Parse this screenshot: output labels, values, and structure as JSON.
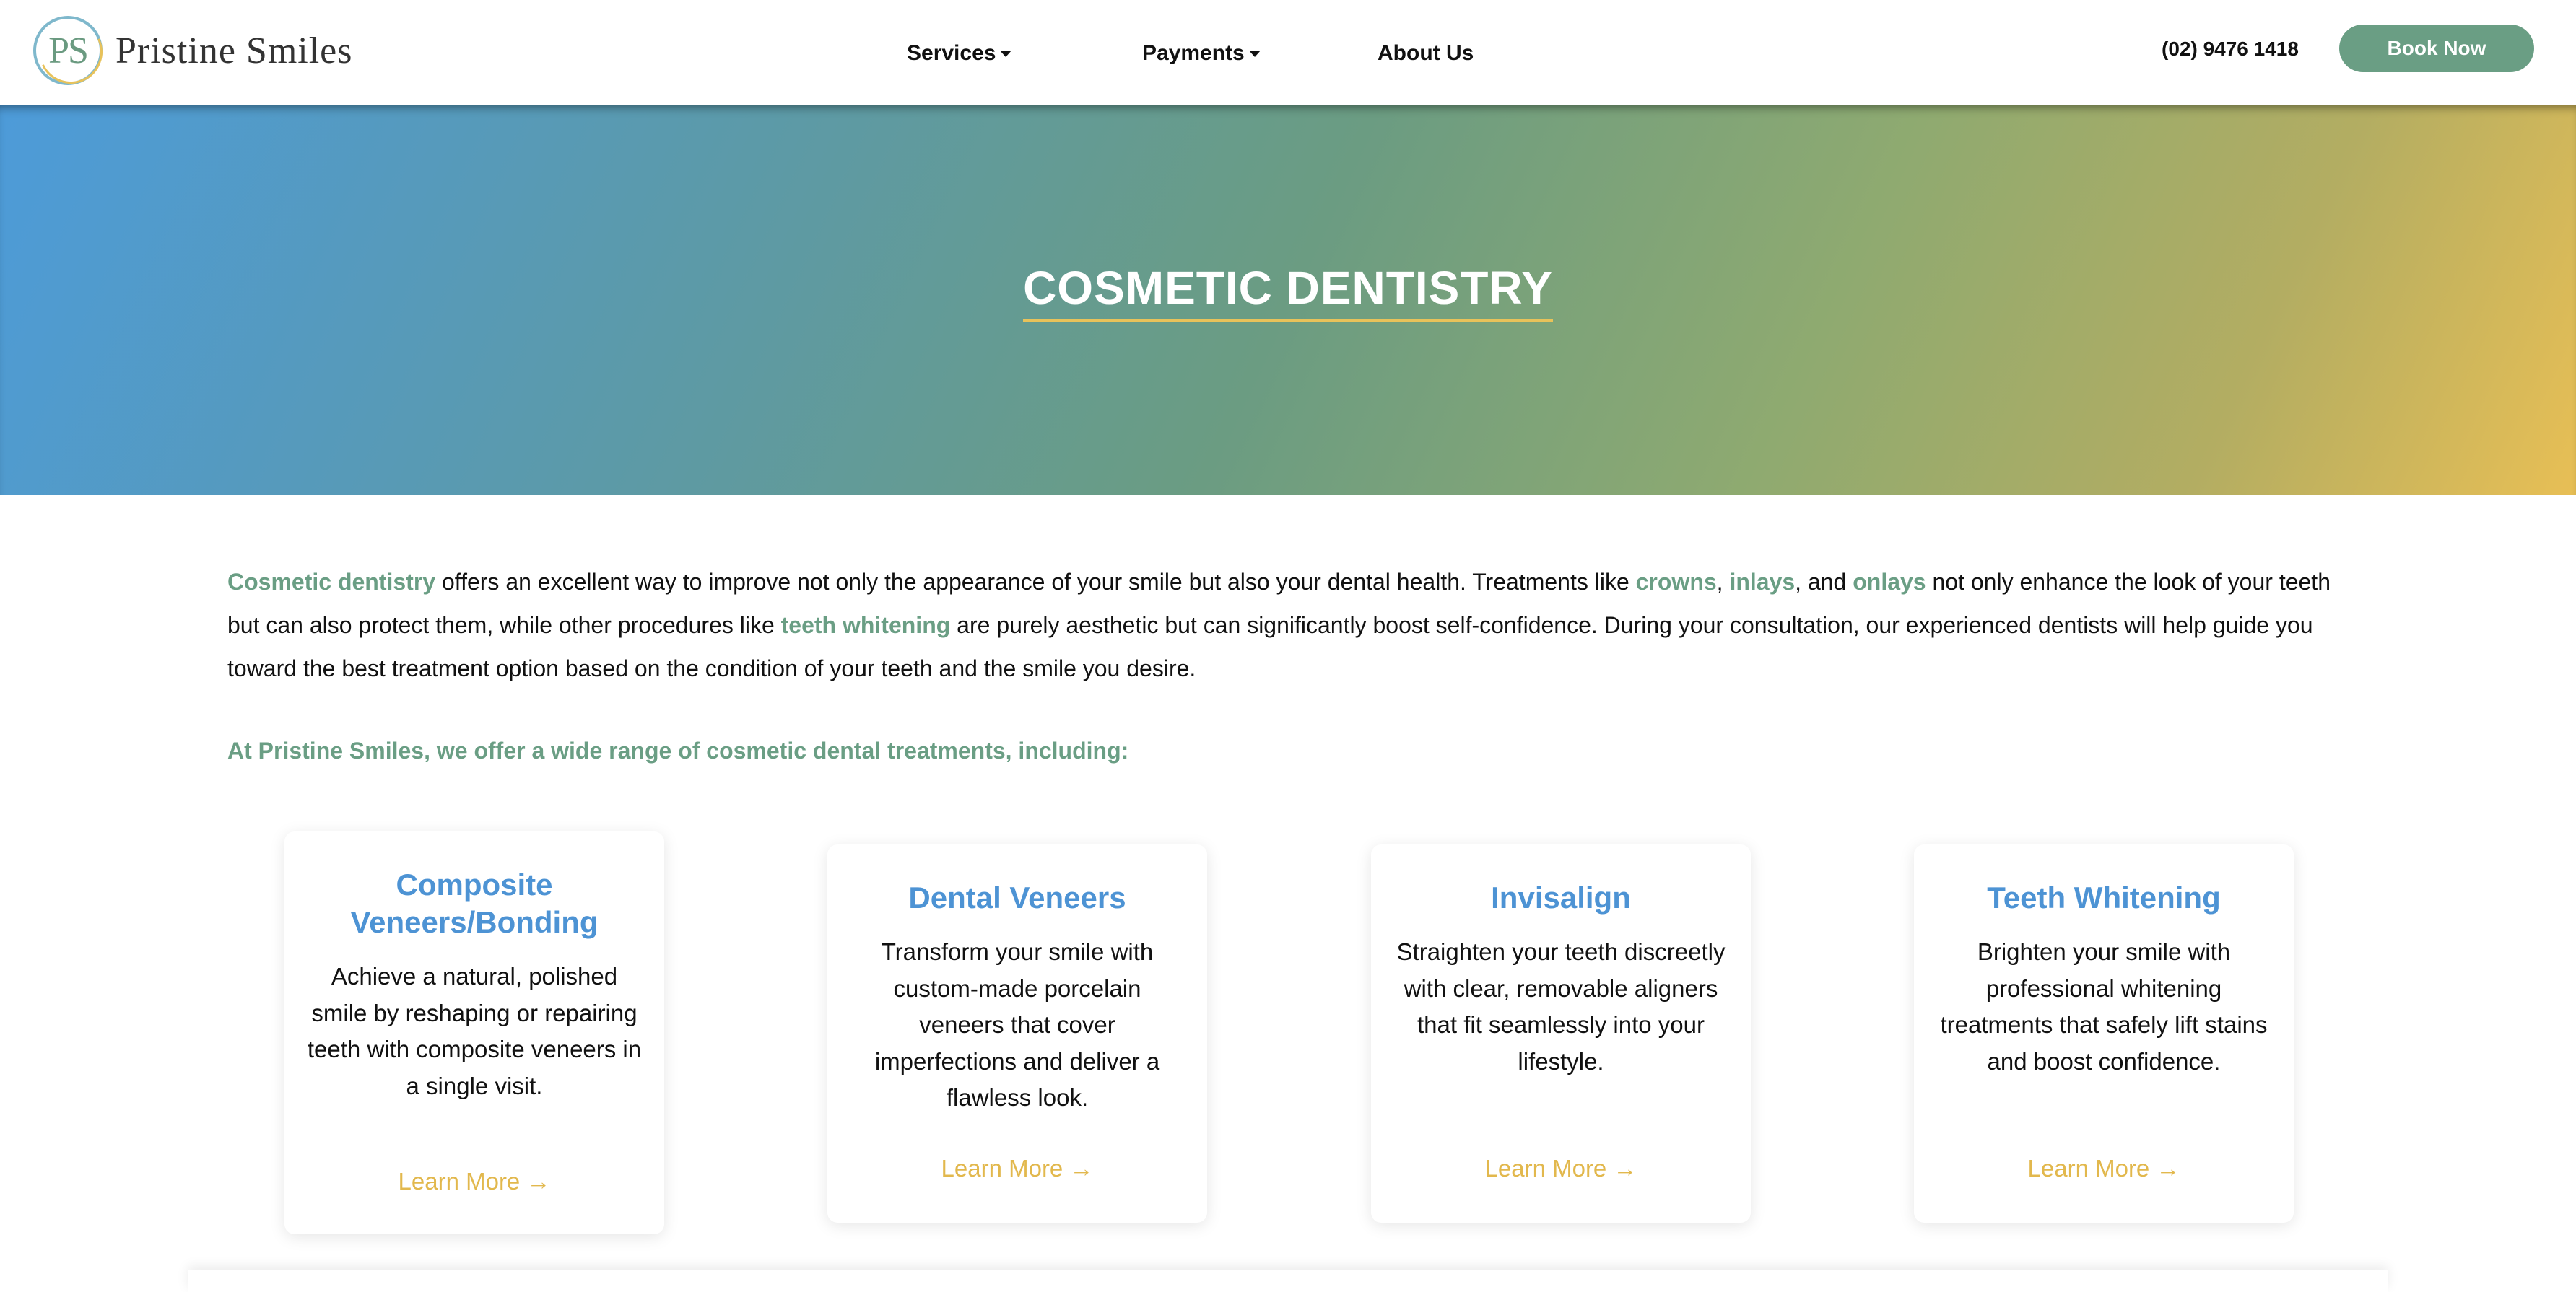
{
  "header": {
    "logo_initials": "PS",
    "logo_text": "Pristine Smiles",
    "nav": [
      {
        "label": "Services",
        "has_dropdown": true
      },
      {
        "label": "Payments",
        "has_dropdown": true
      },
      {
        "label": "About Us",
        "has_dropdown": false
      }
    ],
    "phone": "(02) 9476 1418",
    "book_label": "Book Now"
  },
  "hero": {
    "title": "COSMETIC DENTISTRY"
  },
  "intro": {
    "segments": [
      {
        "text": "Cosmetic dentistry",
        "highlight": true
      },
      {
        "text": " offers an excellent way to improve not only the appearance of your smile but also your dental health. Treatments like ",
        "highlight": false
      },
      {
        "text": "crowns",
        "highlight": true
      },
      {
        "text": ", ",
        "highlight": false
      },
      {
        "text": "inlays",
        "highlight": true
      },
      {
        "text": ", and ",
        "highlight": false
      },
      {
        "text": "onlays",
        "highlight": true
      },
      {
        "text": " not only enhance the look of your teeth but can also protect them, while other procedures like ",
        "highlight": false
      },
      {
        "text": "teeth whitening",
        "highlight": true
      },
      {
        "text": " are purely aesthetic but can significantly boost self-confidence. During your consultation, our experienced dentists will help guide you toward the best treatment option based on the condition of your teeth and the smile you desire.",
        "highlight": false
      }
    ],
    "subheading": "At Pristine Smiles, we offer a wide range of cosmetic dental treatments, including:"
  },
  "cards": [
    {
      "title": "Composite Veneers/Bonding",
      "text": "Achieve a natural, polished smile by reshaping or repairing teeth with composite veneers in a single visit.",
      "link": "Learn More →"
    },
    {
      "title": "Dental Veneers",
      "text": "Transform your smile with custom-made porcelain veneers that cover imperfections and deliver a flawless look.",
      "link": "Learn More →"
    },
    {
      "title": "Invisalign",
      "text": "Straighten your teeth discreetly with clear, removable aligners that fit seamlessly into your lifestyle.",
      "link": "Learn More →"
    },
    {
      "title": "Teeth Whitening",
      "text": "Brighten your smile with professional whitening treatments that safely lift stains and boost confidence.",
      "link": "Learn More →"
    }
  ],
  "colors": {
    "accent_green": "#6a9e84",
    "title_blue": "#4d93d4",
    "link_gold": "#e2b84d",
    "hero_gradient_start": "#4d9bd9",
    "hero_gradient_end": "#e8bf55"
  }
}
